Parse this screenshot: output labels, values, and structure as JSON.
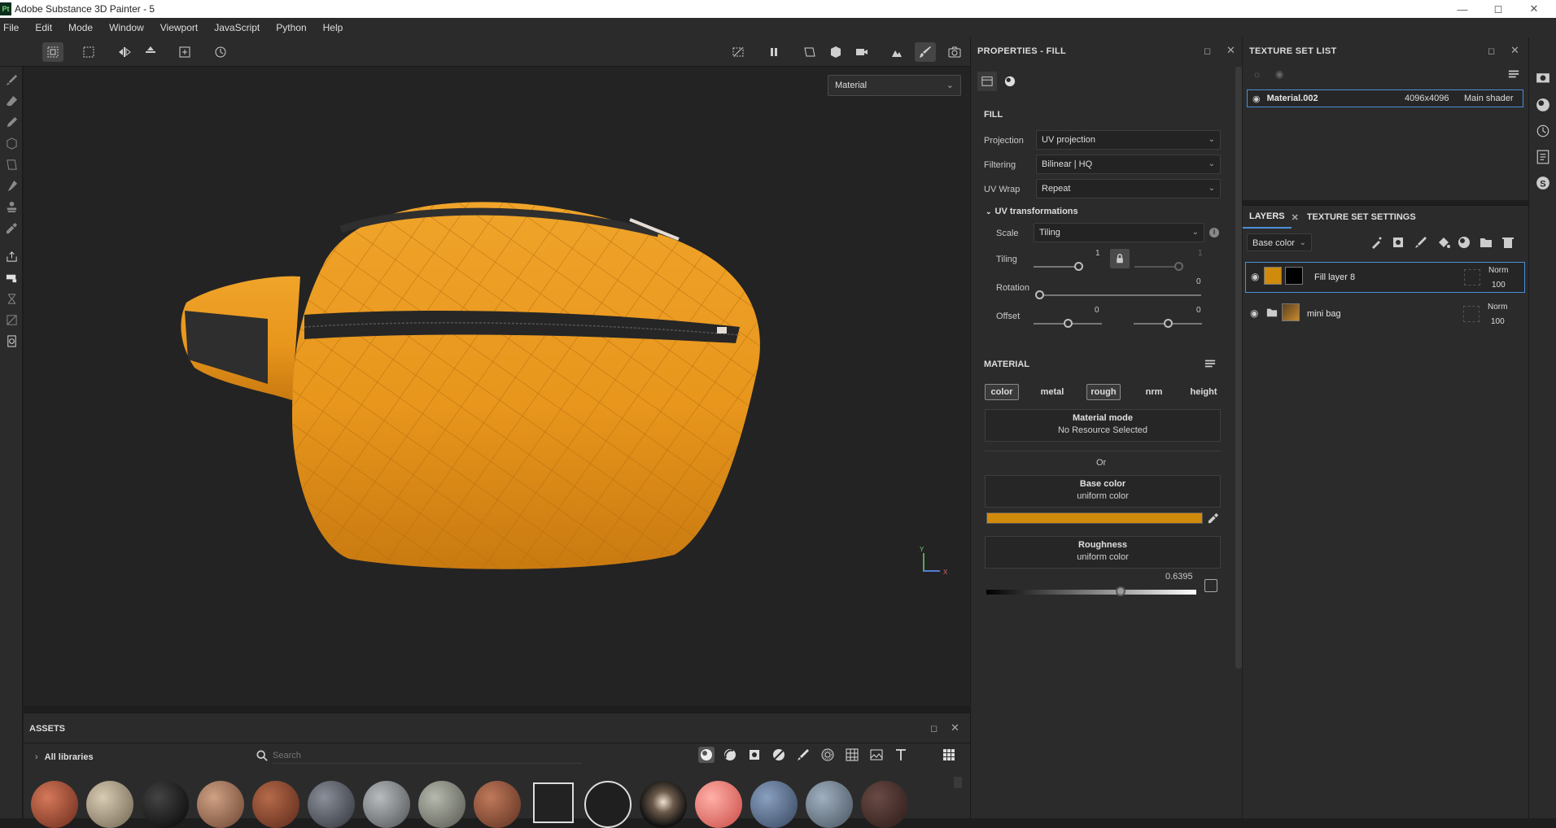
{
  "window": {
    "title": "Adobe Substance 3D Painter - 5",
    "logo": "Pt"
  },
  "menu": [
    "File",
    "Edit",
    "Mode",
    "Window",
    "Viewport",
    "JavaScript",
    "Python",
    "Help"
  ],
  "viewport": {
    "mode_select": "Material",
    "axis_y": "Y",
    "axis_x": "X"
  },
  "properties": {
    "title": "PROPERTIES - FILL",
    "section_fill": "FILL",
    "projection_label": "Projection",
    "projection_value": "UV projection",
    "filtering_label": "Filtering",
    "filtering_value": "Bilinear | HQ",
    "uvwrap_label": "UV Wrap",
    "uvwrap_value": "Repeat",
    "uv_transform_label": "UV transformations",
    "scale_label": "Scale",
    "scale_value": "Tiling",
    "tiling_label": "Tiling",
    "tiling_u": "1",
    "tiling_v": "1",
    "rotation_label": "Rotation",
    "rotation_value": "0",
    "offset_label": "Offset",
    "offset_u": "0",
    "offset_v": "0",
    "section_material": "MATERIAL",
    "channels": [
      "color",
      "metal",
      "rough",
      "nrm",
      "height"
    ],
    "material_mode_title": "Material mode",
    "material_mode_sub": "No Resource Selected",
    "or_label": "Or",
    "base_color_title": "Base color",
    "base_color_sub": "uniform color",
    "base_color_hex": "#d08a0c",
    "roughness_title": "Roughness",
    "roughness_sub": "uniform color",
    "roughness_value": "0.6395",
    "roughness_fraction": 0.6395
  },
  "texture_set_list": {
    "title": "TEXTURE SET LIST",
    "material_name": "Material.002",
    "resolution": "4096x4096",
    "shader": "Main shader"
  },
  "layers": {
    "tab_layers": "LAYERS",
    "tab_tss": "TEXTURE SET SETTINGS",
    "channel_select": "Base color",
    "items": [
      {
        "name": "Fill layer 8",
        "blend": "Norm",
        "opacity": "100"
      },
      {
        "name": "mini bag",
        "blend": "Norm",
        "opacity": "100"
      }
    ]
  },
  "assets": {
    "title": "ASSETS",
    "library": "All libraries",
    "search_placeholder": "Search"
  },
  "colors": {
    "accent": "#4a90d9",
    "bag_orange": "#e8961c",
    "panel": "#2b2b2b"
  }
}
